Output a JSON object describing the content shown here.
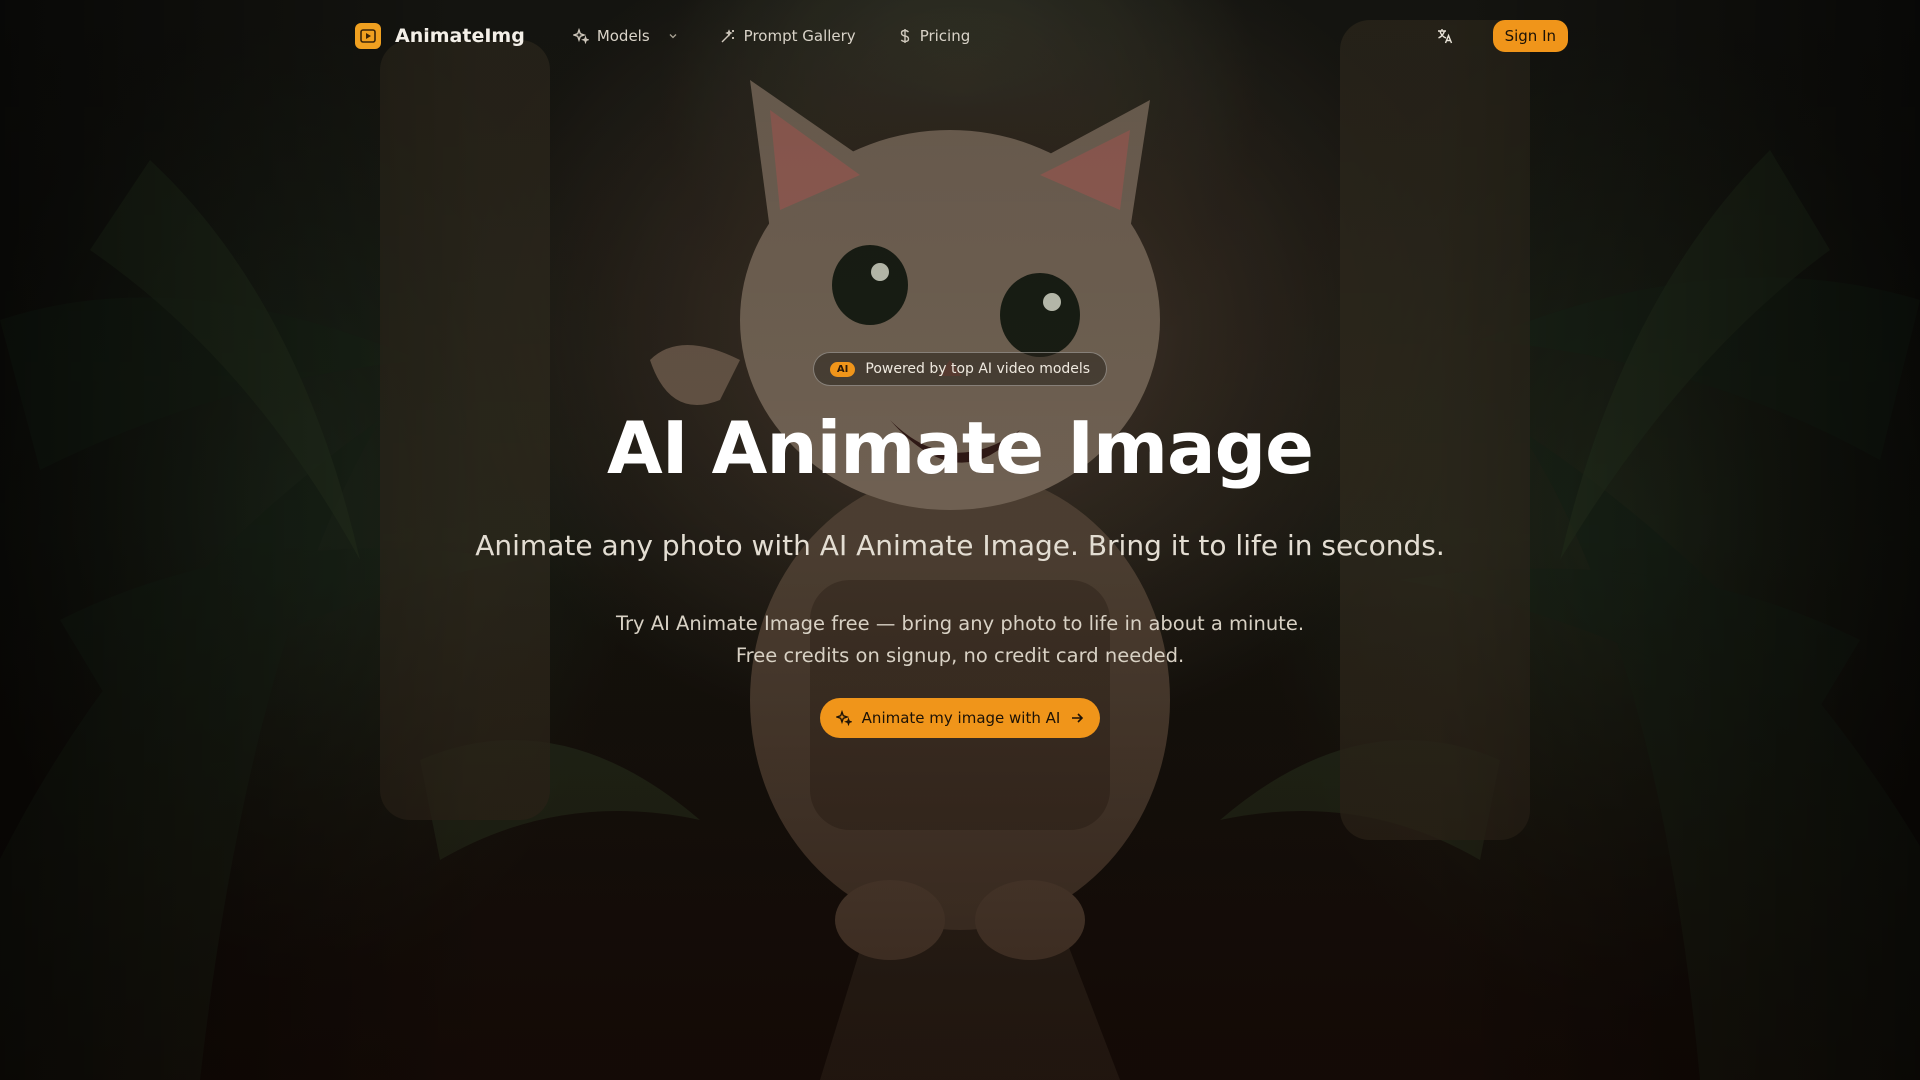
{
  "brand": {
    "name": "AnimateImg",
    "logo_icon": "play-icon"
  },
  "nav": {
    "items": [
      {
        "label": "Models",
        "icon": "sparkles-icon",
        "has_dropdown": true
      },
      {
        "label": "Prompt Gallery",
        "icon": "magic-wand-icon"
      },
      {
        "label": "Pricing",
        "icon": "dollar-icon"
      }
    ],
    "language_icon": "translate-icon",
    "sign_in_label": "Sign In"
  },
  "hero": {
    "badge_tag": "AI",
    "badge_text": "Powered by top AI video models",
    "title": "AI Animate Image",
    "subtitle": "Animate any photo with AI Animate Image. Bring it to life in seconds.",
    "description_line1": "Try AI Animate Image free — bring any photo to life in about a minute.",
    "description_line2": "Free credits on signup, no credit card needed.",
    "cta_label": "Animate my image with AI",
    "cta_icon": "sparkles-icon",
    "cta_arrow_icon": "arrow-right-icon",
    "background": "jungle-kitten-photo"
  },
  "colors": {
    "accent": "#f0951a",
    "text": "#ffffff",
    "background": "#0b0a08"
  }
}
